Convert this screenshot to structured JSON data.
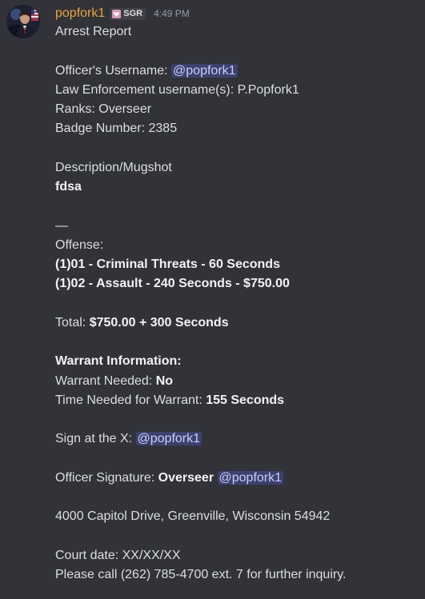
{
  "author": {
    "username": "popfork1",
    "tag": "SGR",
    "timestamp": "4:49 PM",
    "avatar_icon": "avatar-image",
    "tag_icon": "heart-badge-icon",
    "name_color": "#e8a33d"
  },
  "report": {
    "title": "Arrest Report",
    "officer_username_label": "Officer's Username: ",
    "officer_mention": "@popfork1",
    "le_usernames": "Law Enforcement username(s): P.Popfork1",
    "ranks": "Ranks: Overseer",
    "badge": "Badge Number: 2385",
    "description_label": "Description/Mugshot",
    "description_value": "fdsa",
    "separator": "—",
    "offense_label": "Offense:",
    "offenses": [
      "(1)01 - Criminal Threats - 60 Seconds",
      "(1)02 - Assault - 240 Seconds - $750.00"
    ],
    "total_label": "Total: ",
    "total_value": "$750.00 + 300 Seconds",
    "warrant_heading": "Warrant Information:",
    "warrant_needed_label": "Warrant Needed: ",
    "warrant_needed_value": "No",
    "warrant_time_label": "Time Needed for Warrant: ",
    "warrant_time_value": "155 Seconds",
    "sign_label": "Sign at the X: ",
    "sign_mention": "@popfork1",
    "signature_label": "Officer Signature: ",
    "signature_rank": "Overseer",
    "signature_mention": "@popfork1",
    "address": "4000 Capitol Drive, Greenville, Wisconsin 54942",
    "court_date": "Court date: XX/XX/XX",
    "phone_line": "Please call (262) 785-4700 ext. 7 for further inquiry."
  },
  "colors": {
    "background": "#313338",
    "mention_bg": "rgba(88,101,242,0.3)",
    "mention_text": "#c9cdfb"
  }
}
